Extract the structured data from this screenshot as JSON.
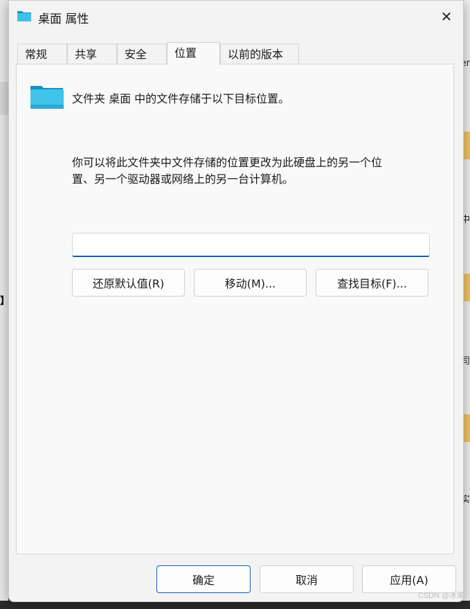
{
  "window": {
    "title": "桌面 属性",
    "close_label": "✕"
  },
  "tabs": [
    {
      "label": "常规"
    },
    {
      "label": "共享"
    },
    {
      "label": "安全"
    },
    {
      "label": "位置"
    },
    {
      "label": "以前的版本"
    }
  ],
  "active_tab": "位置",
  "location": {
    "intro": "文件夹 桌面 中的文件存储于以下目标位置。",
    "description_line1": "你可以将此文件夹中文件存储的位置更改为此硬盘上的另一个位",
    "description_line2": "置、另一个驱动器或网络上的另一台计算机。",
    "path_value": "",
    "restore_button": "还原默认值(R)",
    "move_button": "移动(M)...",
    "find_target_button": "查找目标(F)..."
  },
  "footer": {
    "ok": "确定",
    "cancel": "取消",
    "apply": "应用(A)"
  },
  "background": {
    "left_bracket": "】",
    "right_text_1": "er",
    "right_text_2": "中",
    "right_text_3": "司",
    "right_text_4": "实"
  },
  "watermark": "CSDN @冰茉",
  "colors": {
    "accent": "#0f5fb8",
    "folder_icon": "#3fc0e6"
  },
  "icons": {
    "title": "folder-icon",
    "location": "folder-icon",
    "close": "close-icon"
  }
}
